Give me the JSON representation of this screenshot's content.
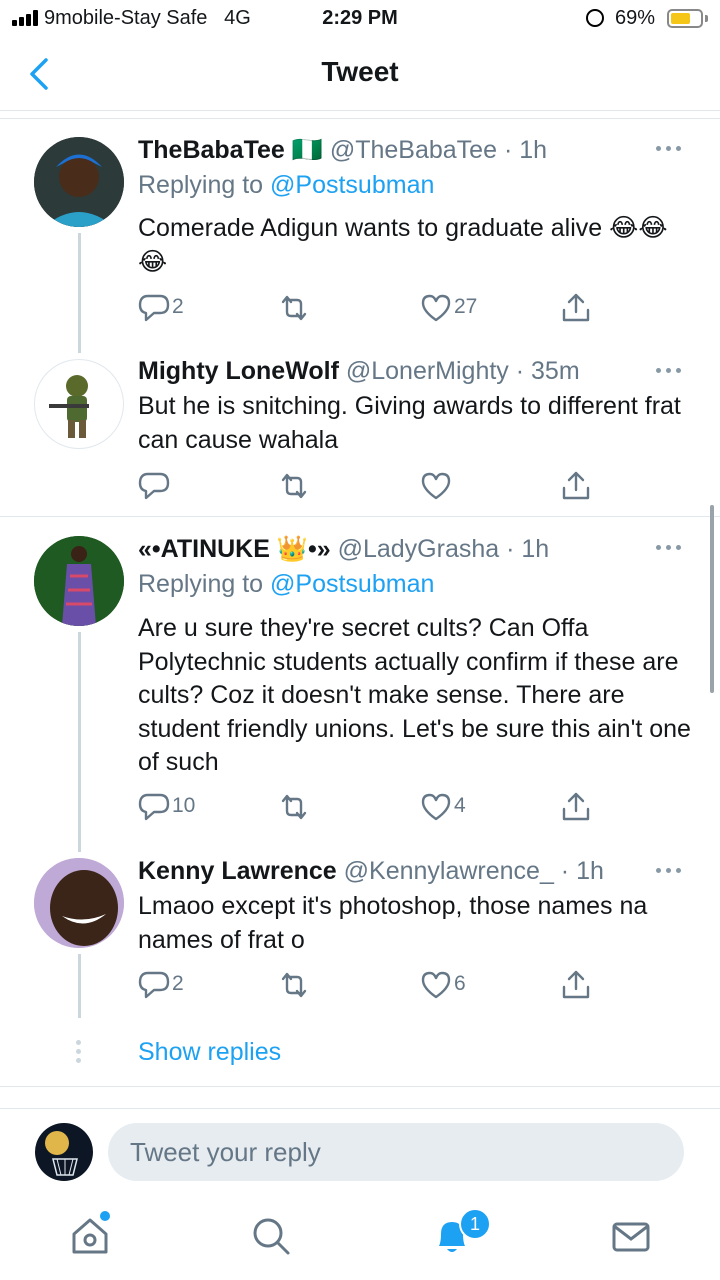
{
  "status_bar": {
    "carrier": "9mobile-Stay Safe",
    "network": "4G",
    "time": "2:29 PM",
    "battery_percent": "69%",
    "battery_level": 0.69
  },
  "header": {
    "title": "Tweet",
    "back_icon": "chevron-left-icon"
  },
  "tweets": [
    {
      "name": "TheBabaTee 🇳🇬",
      "handle": "@TheBabaTee · 1h",
      "replying_prefix": "Replying to ",
      "replying_to": "@Postsubman",
      "text": "Comerade Adigun wants to graduate alive 😂😂😂",
      "replies": "2",
      "retweets": "",
      "likes": "27"
    },
    {
      "name": "Mighty LoneWolf",
      "handle": "@LonerMighty · 35m",
      "text": "But he is snitching. Giving awards to different frat can cause wahala",
      "replies": "",
      "retweets": "",
      "likes": ""
    },
    {
      "name": "«•ATINUKE 👑•»",
      "handle": "@LadyGrasha · 1h",
      "replying_prefix": "Replying to ",
      "replying_to": "@Postsubman",
      "text": "Are u sure they're secret cults? Can Offa Polytechnic students actually confirm if these are cults? Coz it doesn't make sense. There are student friendly unions. Let's be sure this ain't one of such",
      "replies": "10",
      "retweets": "",
      "likes": "4"
    },
    {
      "name": "Kenny Lawrence",
      "handle": "@Kennylawrence_ · 1h",
      "text": "Lmaoo except it's photoshop, those names na names of frat o",
      "replies": "2",
      "retweets": "",
      "likes": "6"
    }
  ],
  "show_replies": "Show replies",
  "reply_bar": {
    "placeholder": "Tweet your reply"
  },
  "tabbar": {
    "items": [
      "home-icon",
      "search-icon",
      "notifications-icon",
      "messages-icon"
    ],
    "notification_count": "1"
  },
  "colors": {
    "accent": "#1da1f2",
    "muted": "#657786",
    "divider": "#e1e8ed"
  }
}
